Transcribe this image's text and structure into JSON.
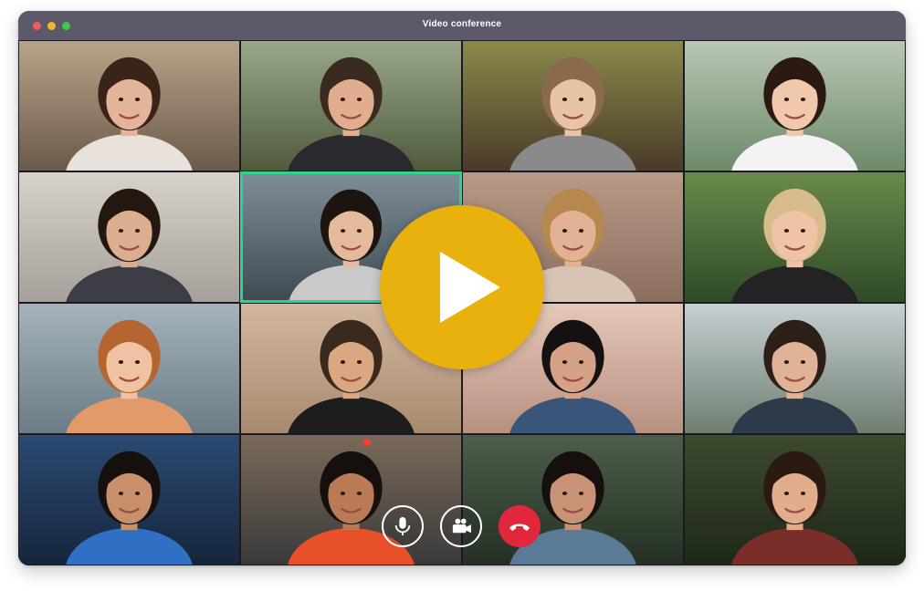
{
  "window": {
    "title": "Video conference",
    "traffic_lights": [
      "close",
      "minimize",
      "zoom"
    ]
  },
  "participants": [
    {
      "bg": [
        "#b7a489",
        "#6b5a4a"
      ],
      "skin": "#e2b59a",
      "hair": "#3a2418",
      "shirt": "#e8e2da"
    },
    {
      "bg": [
        "#9aa88a",
        "#4f5a3d"
      ],
      "skin": "#e0ad8e",
      "hair": "#3b2a1f",
      "shirt": "#2a2a2e"
    },
    {
      "bg": [
        "#8a8a4a",
        "#4a3a2a"
      ],
      "skin": "#e8c4a6",
      "hair": "#8a6a4a",
      "shirt": "#8a8a8a"
    },
    {
      "bg": [
        "#b9c7b3",
        "#6d8a6a"
      ],
      "skin": "#f0c9ad",
      "hair": "#2a1a12",
      "shirt": "#f3f3f3"
    },
    {
      "bg": [
        "#d8d2cc",
        "#a7a09a"
      ],
      "skin": "#dcae90",
      "hair": "#24170f",
      "shirt": "#3d3d46"
    },
    {
      "bg": [
        "#7e8e98",
        "#3e4a52"
      ],
      "skin": "#e5b99c",
      "hair": "#1d1410",
      "shirt": "#c9c9c9"
    },
    {
      "bg": [
        "#b89a86",
        "#8a6e5e"
      ],
      "skin": "#e3b295",
      "hair": "#b6874f",
      "shirt": "#d7c4b4"
    },
    {
      "bg": [
        "#6a8a4c",
        "#2f4a28"
      ],
      "skin": "#efc4a6",
      "hair": "#d8bb8a",
      "shirt": "#232323"
    },
    {
      "bg": [
        "#a4b3bc",
        "#6b7c86"
      ],
      "skin": "#f0c2a2",
      "hair": "#b5652f",
      "shirt": "#e39a6a"
    },
    {
      "bg": [
        "#d2b7a0",
        "#a88a70"
      ],
      "skin": "#d9a883",
      "hair": "#3a2a1e",
      "shirt": "#1d1d1d"
    },
    {
      "bg": [
        "#e5c8b8",
        "#b89080"
      ],
      "skin": "#d6a287",
      "hair": "#151012",
      "shirt": "#39557a"
    },
    {
      "bg": [
        "#c7cfd3",
        "#6f7e70"
      ],
      "skin": "#e0b396",
      "hair": "#2b1f18",
      "shirt": "#2d3a4a"
    },
    {
      "bg": [
        "#2b4a72",
        "#16263c"
      ],
      "skin": "#c9916a",
      "hair": "#15100e",
      "shirt": "#2f6fc4"
    },
    {
      "bg": [
        "#7a6a5a",
        "#3a3a3a"
      ],
      "skin": "#b97a55",
      "hair": "#15100e",
      "shirt": "#e8502a"
    },
    {
      "bg": [
        "#4d5e4a",
        "#243024"
      ],
      "skin": "#c89274",
      "hair": "#15100e",
      "shirt": "#5a7a96"
    },
    {
      "bg": [
        "#3d4a2e",
        "#1e2818"
      ],
      "skin": "#e2ad8c",
      "hair": "#2a1a12",
      "shirt": "#7a2e2a"
    }
  ],
  "active_speaker_index": 5,
  "overlay": {
    "play_icon": "play-icon",
    "play_color": "#e8b10e"
  },
  "controls": {
    "mic_icon": "microphone-icon",
    "camera_icon": "video-camera-icon",
    "hangup_icon": "hang-up-phone-icon",
    "hangup_color": "#e2263c"
  },
  "colors": {
    "titlebar": "#5c596b",
    "active_border": "#2fd38a"
  }
}
